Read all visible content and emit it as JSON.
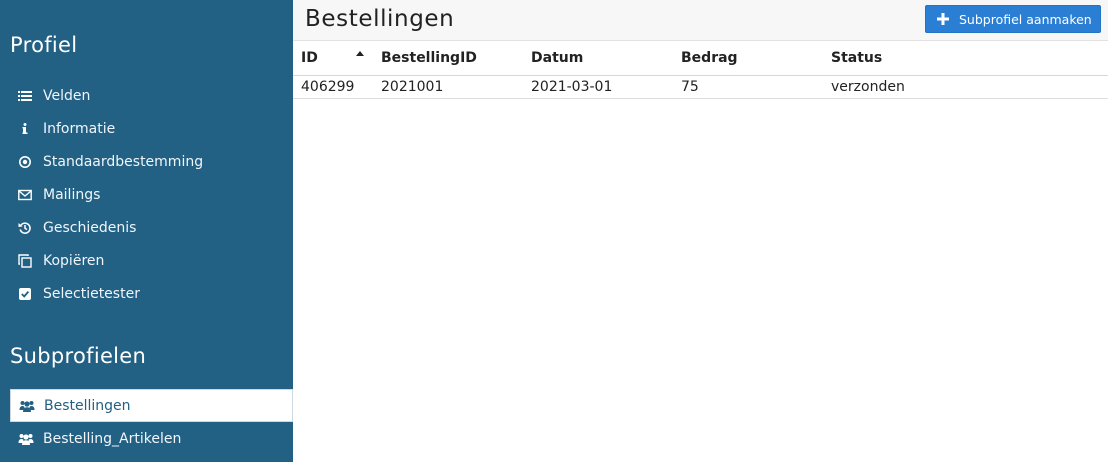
{
  "sidebar": {
    "profile_heading": "Profiel",
    "menu": [
      {
        "label": "Velden",
        "icon": "list-icon"
      },
      {
        "label": "Informatie",
        "icon": "info-icon"
      },
      {
        "label": "Standaardbestemming",
        "icon": "target-icon"
      },
      {
        "label": "Mailings",
        "icon": "envelope-icon"
      },
      {
        "label": "Geschiedenis",
        "icon": "history-icon"
      },
      {
        "label": "Kopiëren",
        "icon": "copy-icon"
      },
      {
        "label": "Selectietester",
        "icon": "checkbox-icon"
      }
    ],
    "subprofiles_heading": "Subprofielen",
    "subprofiles": [
      {
        "label": "Bestellingen",
        "icon": "users-icon",
        "active": true
      },
      {
        "label": "Bestelling_Artikelen",
        "icon": "users-icon",
        "active": false
      }
    ]
  },
  "main": {
    "title": "Bestellingen",
    "add_button": "Subprofiel aanmaken",
    "table": {
      "columns": [
        "ID",
        "BestellingID",
        "Datum",
        "Bedrag",
        "Status"
      ],
      "sorted_column": "ID",
      "sort_direction": "ascending",
      "rows": [
        [
          "406299",
          "2021001",
          "2021-03-01",
          "75",
          "verzonden"
        ]
      ]
    }
  },
  "colors": {
    "sidebar_bg": "#226084",
    "accent_button": "#2a7fd4"
  }
}
